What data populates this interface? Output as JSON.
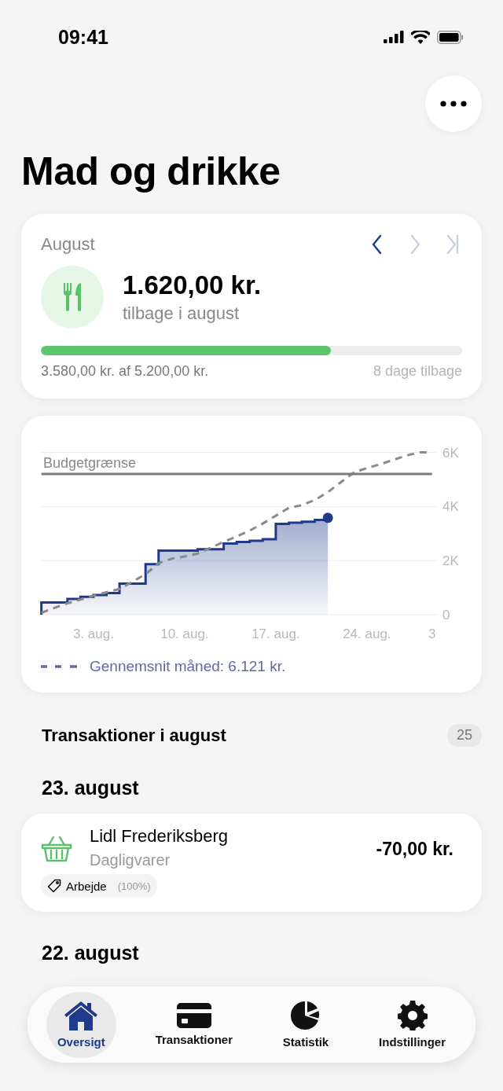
{
  "status_bar": {
    "time": "09:41"
  },
  "title": "Mad og drikke",
  "summary": {
    "month": "August",
    "nav": [
      {
        "kind": "prev",
        "disabled": false
      },
      {
        "kind": "next",
        "disabled": true
      },
      {
        "kind": "last",
        "disabled": true
      }
    ],
    "amount": "1.620,00 kr.",
    "amount_caption": "tilbage i august",
    "level": 0.688,
    "spent": "3.580,00 kr. af 5.200,00 kr.",
    "days_left": "8 dage tilbage"
  },
  "chart": {
    "chart_data": {
      "type": "area",
      "categories": [
        null,
        null,
        null,
        null,
        "3. aug.",
        null,
        null,
        null,
        null,
        null,
        null,
        "10. aug.",
        null,
        null,
        null,
        null,
        null,
        null,
        "17. aug.",
        null,
        null,
        null,
        null,
        null,
        null,
        "24. aug.",
        null,
        null,
        null,
        null,
        "3"
      ],
      "series": [
        {
          "color": "#1f3a8a",
          "values": [
            450,
            450,
            580,
            660,
            730,
            800,
            1150,
            1150,
            1870,
            2370,
            2370,
            2370,
            2420,
            2420,
            2630,
            2690,
            2730,
            2790,
            3360,
            3400,
            3440,
            3500,
            3580,
            null,
            null,
            null,
            null,
            null,
            null,
            null,
            null
          ]
        },
        {
          "name": "Gennemsnit måned: 6.121 kr.",
          "type": "line",
          "line_style": "dashed",
          "color": "#8a8a8a",
          "values": [
            70,
            250,
            420,
            560,
            700,
            830,
            950,
            1220,
            1500,
            1900,
            2070,
            2150,
            2260,
            2480,
            2690,
            2890,
            3110,
            3370,
            3660,
            3950,
            4050,
            4240,
            4530,
            4900,
            5260,
            5420,
            5560,
            5720,
            5880,
            6000,
            6000
          ]
        },
        {
          "name": "Budgetgrænse",
          "type": "line",
          "color": "#7a7a7a",
          "values": [
            5200,
            5200,
            5200,
            5200,
            5200,
            5200,
            5200,
            5200,
            5200,
            5200,
            5200,
            5200,
            5200,
            5200,
            5200,
            5200,
            5200,
            5200,
            5200,
            5200,
            5200,
            5200,
            5200,
            5200,
            5200,
            5200,
            5200,
            5200,
            5200,
            5200,
            5200
          ]
        }
      ],
      "ylim": [
        0,
        6000
      ],
      "grid": true,
      "yticks": [
        {
          "value": 0,
          "label": "0"
        },
        {
          "value": 2000,
          "label": "2K"
        },
        {
          "value": 4000,
          "label": "4K"
        },
        {
          "value": 6000,
          "label": "6K"
        }
      ]
    }
  },
  "transactions_header": {
    "title": "Transaktioner i august",
    "count": "25"
  },
  "days": [
    {
      "date": "23. august",
      "items": [
        {
          "merchant": "Lidl Frederiksberg",
          "category": "Dagligvarer",
          "amount": "-70,00 kr.",
          "tag": "Arbejde",
          "tag_share": "(100%)"
        }
      ]
    },
    {
      "date": "22. august"
    }
  ],
  "tabbar": [
    {
      "kind": "home",
      "label": "Oversigt",
      "selected": true
    },
    {
      "kind": "card",
      "label": "Transaktioner",
      "selected": false
    },
    {
      "kind": "pie",
      "label": "Statistik",
      "selected": false
    },
    {
      "kind": "gear",
      "label": "Indstillinger",
      "selected": false
    }
  ]
}
